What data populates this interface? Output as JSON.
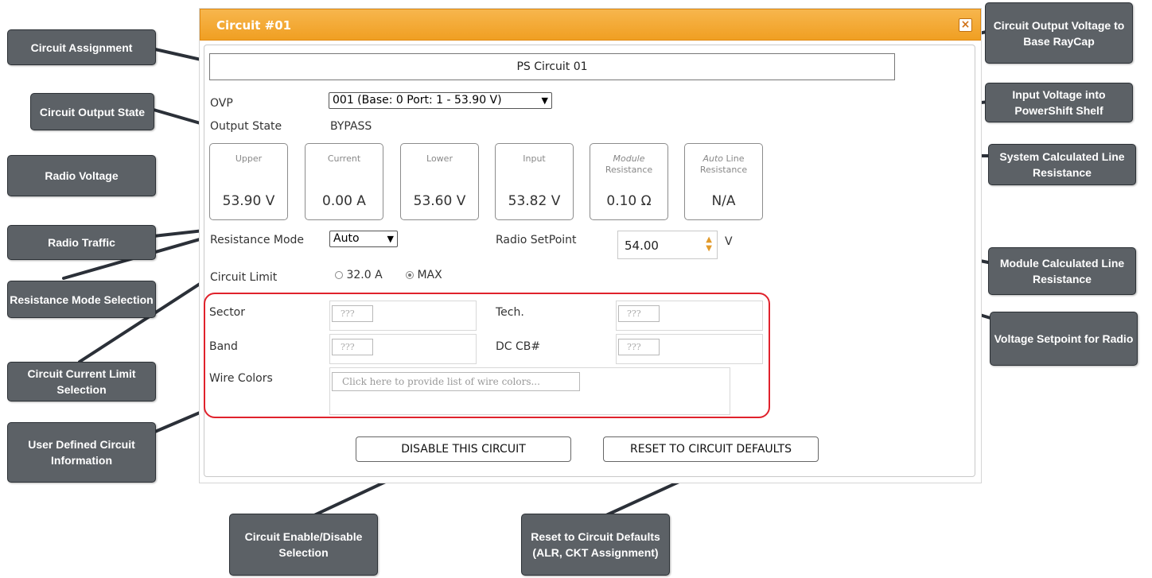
{
  "dialog": {
    "title": "Circuit #01",
    "close_glyph": "×",
    "circuit_name": "PS Circuit 01",
    "ovp_label": "OVP",
    "ovp_value": "001 (Base: 0 Port: 1 - 53.90 V)",
    "output_state_label": "Output State",
    "output_state_value": "BYPASS",
    "cards": [
      {
        "caption": "Upper",
        "value": "53.90 V"
      },
      {
        "caption": "Current",
        "value": "0.00 A"
      },
      {
        "caption": "Lower",
        "value": "53.60 V"
      },
      {
        "caption": "Input",
        "value": "53.82 V"
      },
      {
        "caption_italic": "Module",
        "caption_rest": "Resistance",
        "value": "0.10 Ω"
      },
      {
        "caption_italic": "Auto",
        "caption_rest": "Line Resistance",
        "value": "N/A"
      }
    ],
    "resistance_mode_label": "Resistance Mode",
    "resistance_mode_value": "Auto",
    "radio_setpoint_label": "Radio SetPoint",
    "radio_setpoint_value": "54.00",
    "radio_setpoint_unit": "V",
    "circuit_limit_label": "Circuit Limit",
    "limit_option_1": "32.0 A",
    "limit_option_2": "MAX",
    "limit_selected": "MAX",
    "sector_label": "Sector",
    "tech_label": "Tech.",
    "band_label": "Band",
    "dccb_label": "DC CB#",
    "placeholder_short": "???",
    "wire_colors_label": "Wire Colors",
    "wire_colors_placeholder": "Click here to provide list of wire colors...",
    "disable_button": "DISABLE THIS CIRCUIT",
    "reset_button": "RESET TO CIRCUIT DEFAULTS"
  },
  "callouts": {
    "circuit_assignment": "Circuit Assignment",
    "circuit_output_state": "Circuit Output State",
    "radio_voltage": "Radio Voltage",
    "radio_traffic": "Radio Traffic",
    "resistance_mode_selection": "Resistance Mode Selection",
    "circuit_current_limit_selection": "Circuit Current Limit Selection",
    "user_defined_circuit_information": "User Defined Circuit Information",
    "circuit_output_voltage": "Circuit Output Voltage to Base RayCap",
    "input_voltage": "Input Voltage into PowerShift Shelf",
    "system_calculated_line_resistance": "System Calculated Line Resistance",
    "module_calculated_line_resistance": "Module Calculated Line Resistance",
    "voltage_setpoint_for_radio": "Voltage Setpoint for Radio",
    "circuit_enable_disable": "Circuit Enable/Disable Selection",
    "reset_to_circuit_defaults": "Reset to Circuit Defaults (ALR, CKT Assignment)"
  },
  "colors": {
    "titlebar": "#f0a22a",
    "callout_bg": "#5c6166",
    "highlight_border": "#e0222c",
    "spinner_arrows": "#e29a2b"
  }
}
